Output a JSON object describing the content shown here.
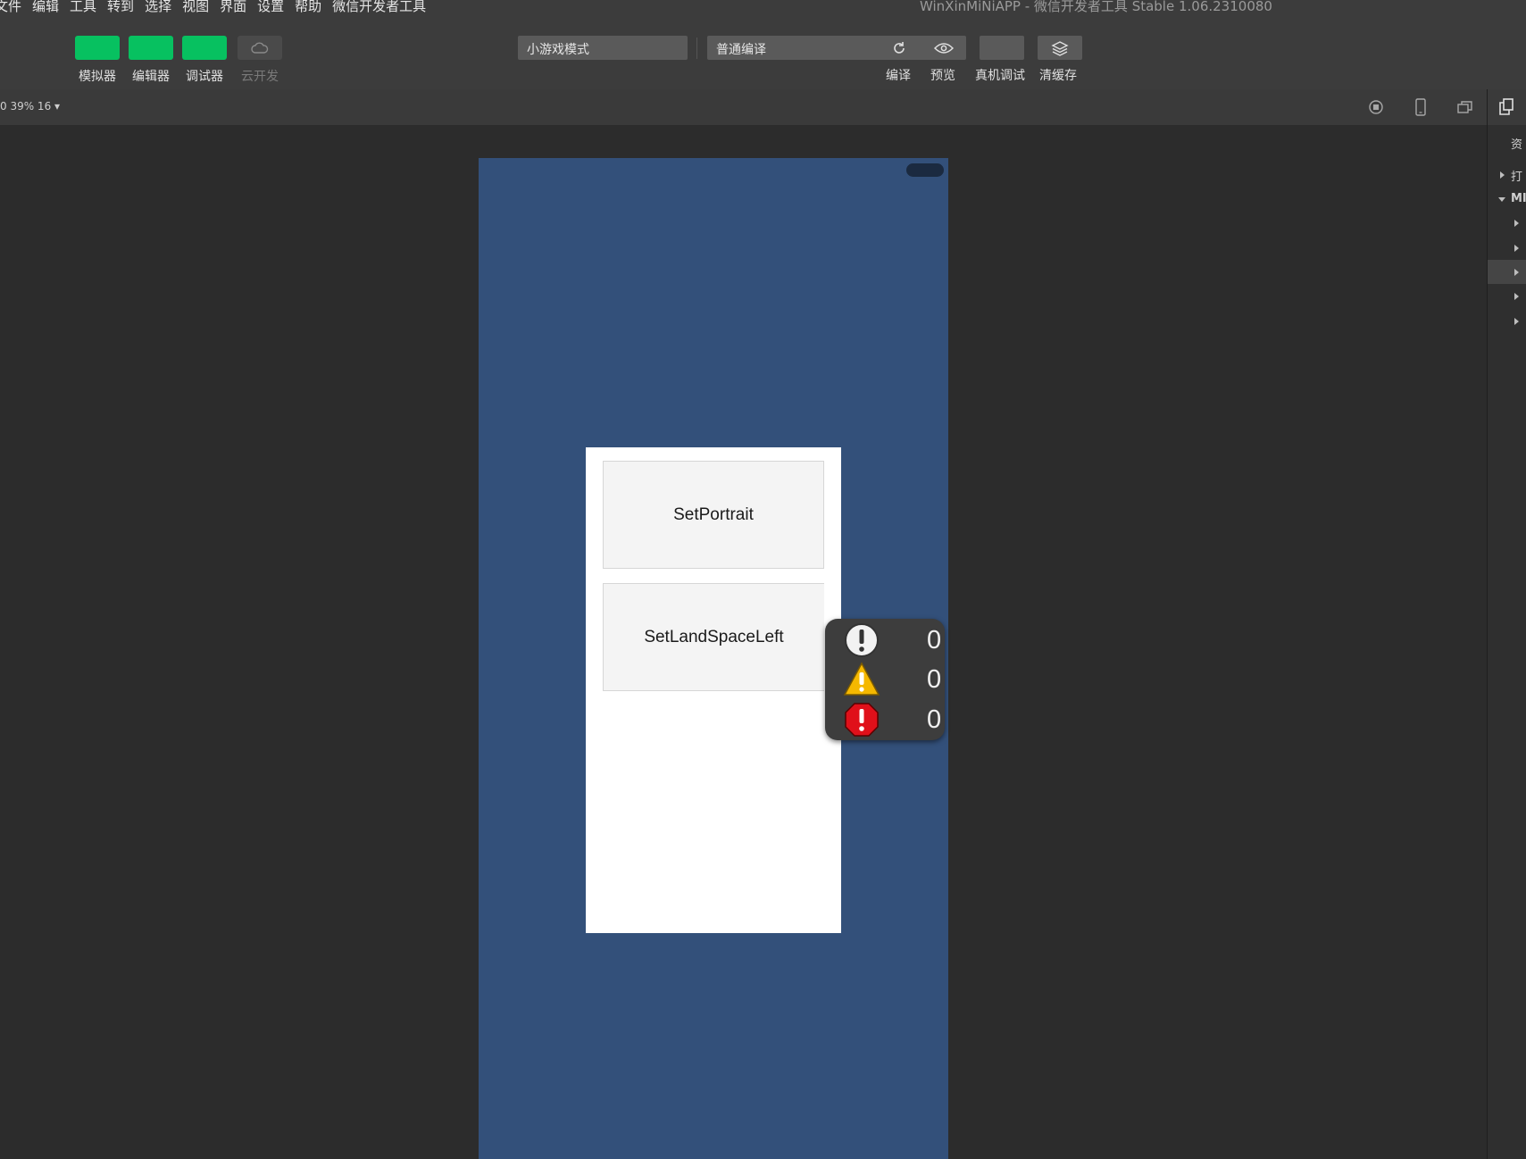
{
  "menu": [
    "文件",
    "编辑",
    "工具",
    "转到",
    "选择",
    "视图",
    "界面",
    "设置",
    "帮助",
    "微信开发者工具"
  ],
  "window_title": "WinXinMiNiAPP - 微信开发者工具 Stable 1.06.2310080",
  "toolbar": {
    "simulator": "模拟器",
    "editor": "编辑器",
    "debugger": "调试器",
    "cloud": "云开发",
    "mode": "小游戏模式",
    "compile_mode": "普通编译",
    "compile": "编译",
    "preview": "预览",
    "real_debug": "真机调试",
    "clear_cache": "清缓存",
    "accent": "#07c160"
  },
  "subbar": {
    "zoom": "0 39% 16 ▾"
  },
  "right_panel": {
    "tab": "资",
    "item1": "打",
    "item2": "MI"
  },
  "game": {
    "bg": "#33507a",
    "buttons": [
      "SetPortrait",
      "SetLandSpaceLeft"
    ]
  },
  "log": {
    "info_count": "0",
    "warning_count": "0",
    "error_count": "0"
  }
}
